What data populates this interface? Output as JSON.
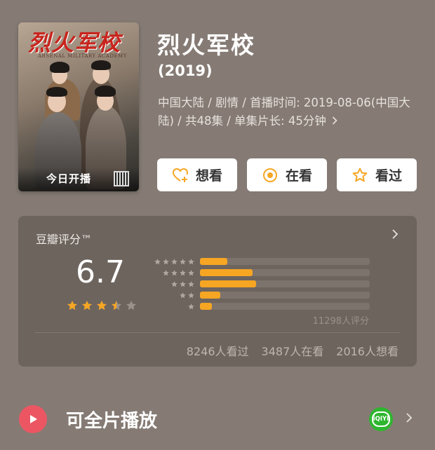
{
  "poster": {
    "title_art": "烈火军校",
    "subtitle_art": "ARSENAL MILITARY ACADEMY",
    "badge": "今日开播"
  },
  "movie": {
    "title": "烈火军校",
    "year": "(2019)",
    "meta": "中国大陆 / 剧情 / 首播时间: 2019-08-06(中国大陆) / 共48集 / 单集片长: 45分钟"
  },
  "actions": {
    "want": "想看",
    "watching": "在看",
    "watched": "看过"
  },
  "rating": {
    "label": "豆瓣评分™",
    "score": "6.7",
    "stars_value": 3.5,
    "distribution": [
      {
        "stars": 5,
        "fraction": 0.16
      },
      {
        "stars": 4,
        "fraction": 0.31
      },
      {
        "stars": 3,
        "fraction": 0.33
      },
      {
        "stars": 2,
        "fraction": 0.12
      },
      {
        "stars": 1,
        "fraction": 0.07
      }
    ],
    "count": "11298人评分",
    "stats": {
      "watched": "8246人看过",
      "watching": "3487人在看",
      "want": "2016人想看"
    }
  },
  "play": {
    "label": "可全片播放",
    "platform_icon": "iqiyi-icon",
    "platform_text": "iQIYI"
  },
  "colors": {
    "background": "#857b74",
    "card": "#6d645e",
    "star": "#f6a623",
    "play_icon": "#ec5663",
    "platform": "#2fb62f"
  }
}
